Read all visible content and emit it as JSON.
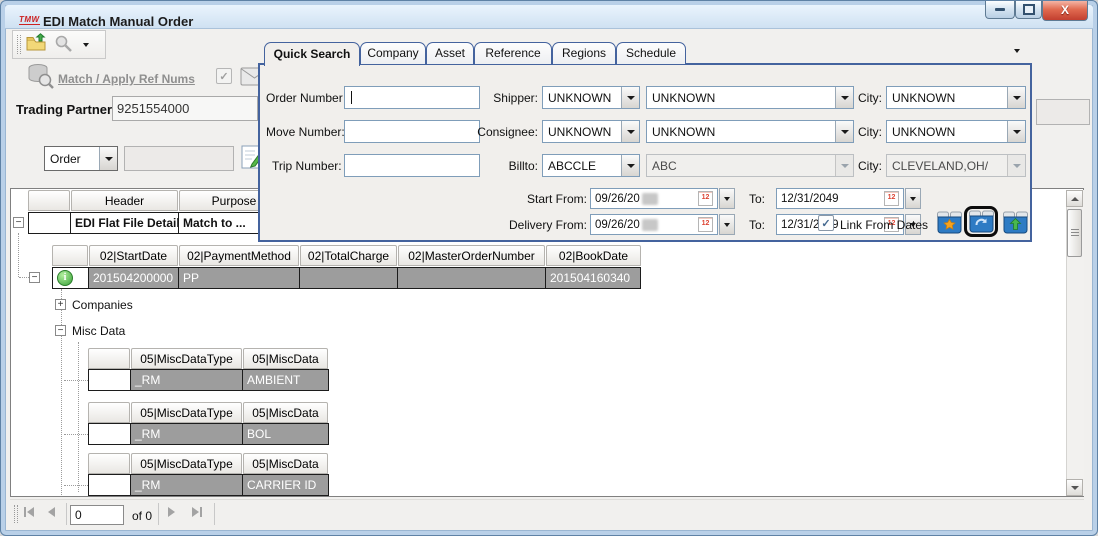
{
  "window": {
    "logo": "TMW",
    "title": "EDI Match Manual Order"
  },
  "header": {
    "match_link": "Match / Apply Ref Nums",
    "trading_partner_label": "Trading Partner:",
    "trading_partner_value": "9251554000",
    "order_type": "Order"
  },
  "dialog": {
    "tabs": [
      "Quick Search",
      "Company",
      "Asset",
      "Reference",
      "Regions",
      "Schedule"
    ],
    "active_tab": "Quick Search",
    "fields": {
      "order_number_label": "Order Number",
      "move_number_label": "Move Number:",
      "trip_number_label": "Trip Number:",
      "shipper_label": "Shipper:",
      "consignee_label": "Consignee:",
      "billto_label": "Billto:",
      "city_label": "City:",
      "shipper_code": "UNKNOWN",
      "shipper_name": "UNKNOWN",
      "shipper_city": "UNKNOWN",
      "consignee_code": "UNKNOWN",
      "consignee_name": "UNKNOWN",
      "consignee_city": "UNKNOWN",
      "billto_code": "ABCCLE",
      "billto_name": "ABC",
      "billto_city": "CLEVELAND,OH/",
      "link_from_dates": "Link From Dates"
    },
    "dates": {
      "start_label": "Start From:",
      "start_from": "09/26/20",
      "to_label": "To:",
      "start_to": "12/31/2049",
      "delivery_label": "Delivery From:",
      "delivery_from": "09/26/20",
      "delivery_to": "12/31/2049"
    }
  },
  "grid": {
    "top": {
      "header": "Header",
      "purpose": "Purpose"
    },
    "root": {
      "details": "EDI Flat File Details",
      "match": "Match to ..."
    },
    "flat": {
      "cols": [
        "02|StartDate",
        "02|PaymentMethod",
        "02|TotalCharge",
        "02|MasterOrderNumber",
        "02|BookDate"
      ],
      "row": [
        "201504200000",
        "PP",
        "",
        "",
        "201504160340"
      ]
    },
    "companies": "Companies",
    "misc_label": "Misc Data",
    "misc": {
      "cols": [
        "05|MiscDataType",
        "05|MiscData"
      ],
      "rows": [
        [
          "_RM",
          "AMBIENT"
        ],
        [
          "_RM",
          "BOL"
        ],
        [
          "_RM",
          "CARRIER ID"
        ]
      ]
    }
  },
  "pager": {
    "value": "0",
    "of": "of 0"
  },
  "colors": {
    "dialog_border": "#44639e",
    "selected_row_bg": "#9d9d9d",
    "titlebar": "#cfe1f2",
    "close_button": "#c23f2f",
    "link_gray": "#8f8f8f"
  },
  "icon_names": [
    "tmw-logo",
    "minimize-icon",
    "maximize-icon",
    "close-icon",
    "open-folder-arrow-icon",
    "search-disabled-icon",
    "dropdown-caret-icon",
    "database-search-icon",
    "envelope-icon",
    "checkbox-check-icon",
    "edit-note-icon",
    "calendar-icon",
    "clear-filter-bin-icon",
    "refresh-bin-icon",
    "submit-bin-icon",
    "info-icon",
    "plus-expander-icon",
    "minus-expander-icon",
    "scroll-up-icon",
    "scroll-down-icon",
    "nav-first-icon",
    "nav-prev-icon",
    "nav-next-icon",
    "nav-last-icon"
  ]
}
